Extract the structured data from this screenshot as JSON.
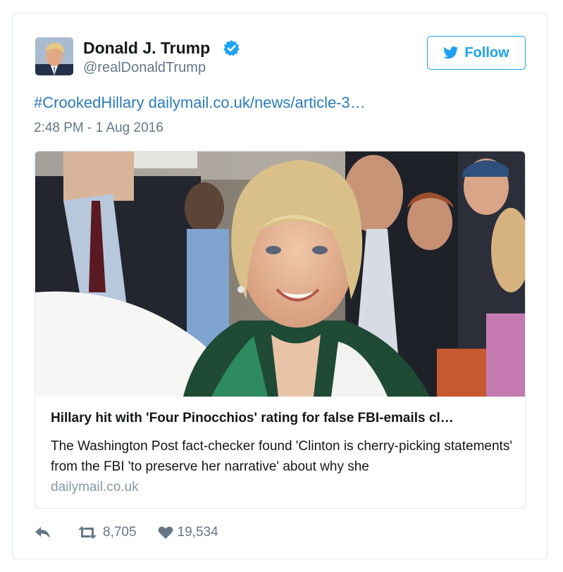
{
  "tweet": {
    "author": {
      "name": "Donald J. Trump",
      "handle": "@realDonaldTrump",
      "verified": true,
      "avatar_icon": "user-avatar"
    },
    "follow_label": "Follow",
    "follow_icon": "bird-icon",
    "text": {
      "hashtag": "#CrookedHillary",
      "link": "dailymail.co.uk/news/article-3…"
    },
    "timestamp": "2:48 PM - 1 Aug 2016",
    "card": {
      "image_icon": "news-photo",
      "title": "Hillary hit with 'Four Pinocchios' rating for false FBI-emails cl…",
      "description": "The Washington Post fact-checker found 'Clinton is cherry-picking statements' from the FBI 'to preserve her narrative' about why she",
      "domain": "dailymail.co.uk"
    },
    "actions": {
      "reply_icon": "reply-icon",
      "retweet_icon": "retweet-icon",
      "retweets": "8,705",
      "like_icon": "heart-icon",
      "likes": "19,534"
    },
    "colors": {
      "accent": "#1da1f2",
      "link": "#2b7bb9",
      "secondary_text": "#657786",
      "border": "#e1e8ed"
    }
  }
}
